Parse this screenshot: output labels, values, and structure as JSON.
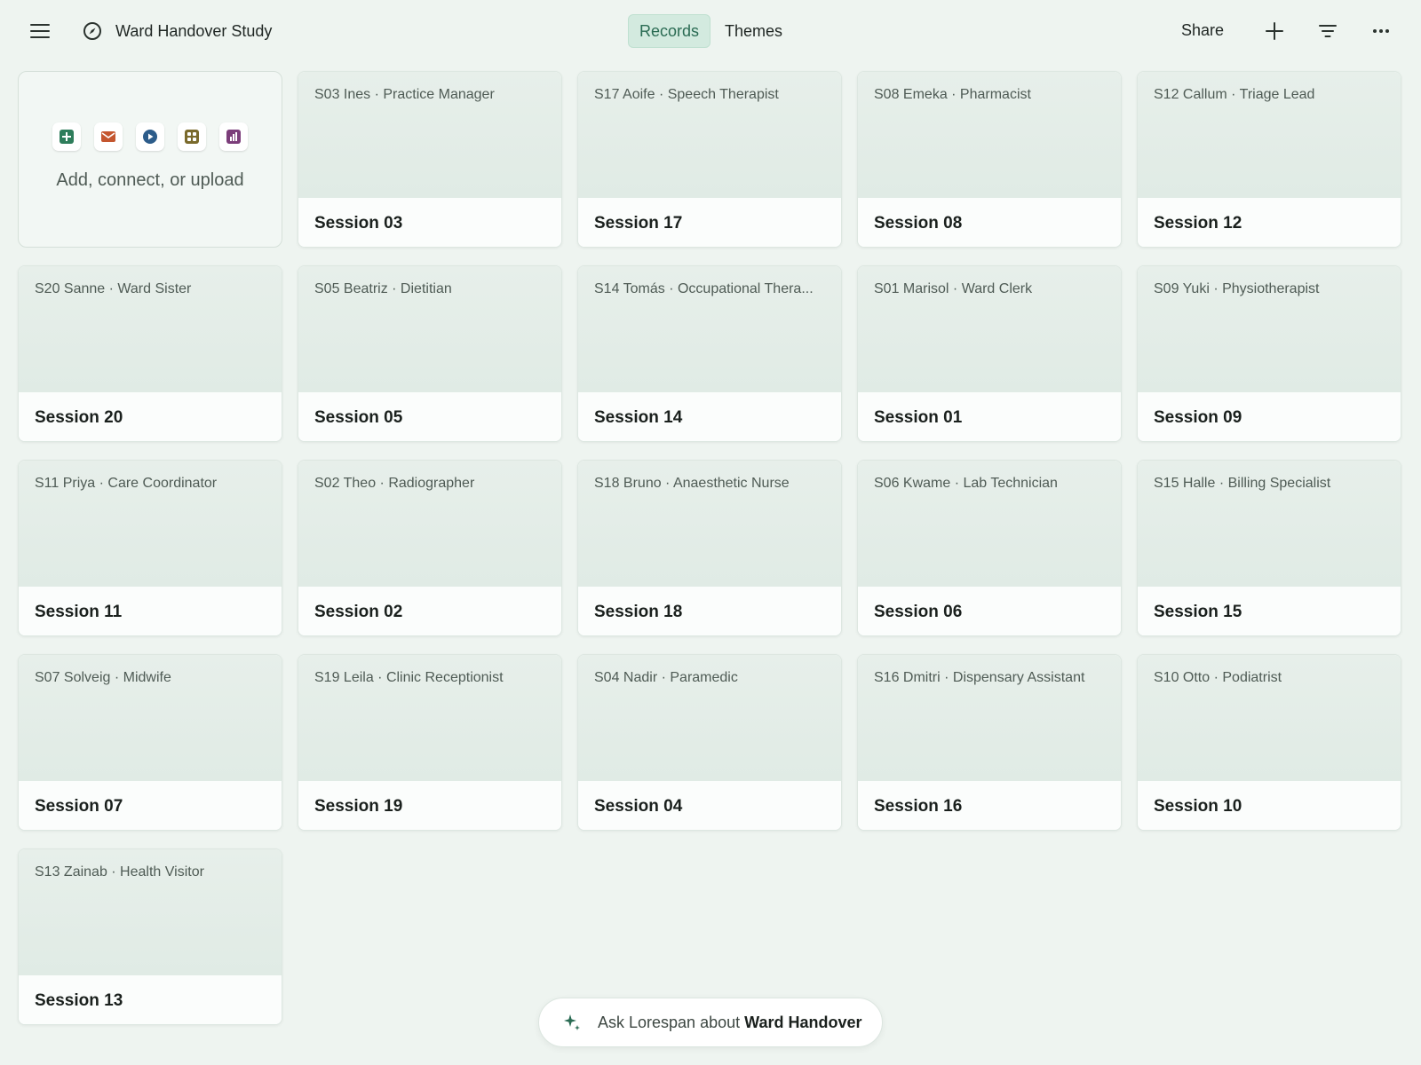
{
  "header": {
    "title": "Ward Handover Study",
    "tabs": [
      {
        "label": "Records",
        "active": true
      },
      {
        "label": "Themes",
        "active": false
      }
    ],
    "share_label": "Share"
  },
  "add_card": {
    "text": "Add, connect, or upload",
    "icons": [
      "add-icon",
      "mail-icon",
      "play-icon",
      "grid-icon",
      "chart-icon"
    ]
  },
  "records": [
    {
      "participant": "S03 Ines · Practice Manager",
      "session": "Session 03"
    },
    {
      "participant": "S17 Aoife · Speech Therapist",
      "session": "Session 17"
    },
    {
      "participant": "S08 Emeka · Pharmacist",
      "session": "Session 08"
    },
    {
      "participant": "S12 Callum · Triage Lead",
      "session": "Session 12"
    },
    {
      "participant": "S20 Sanne · Ward Sister",
      "session": "Session 20"
    },
    {
      "participant": "S05 Beatriz · Dietitian",
      "session": "Session 05"
    },
    {
      "participant": "S14 Tomás · Occupational Thera...",
      "session": "Session 14"
    },
    {
      "participant": "S01 Marisol · Ward Clerk",
      "session": "Session 01"
    },
    {
      "participant": "S09 Yuki · Physiotherapist",
      "session": "Session 09"
    },
    {
      "participant": "S11 Priya · Care Coordinator",
      "session": "Session 11"
    },
    {
      "participant": "S02 Theo · Radiographer",
      "session": "Session 02"
    },
    {
      "participant": "S18 Bruno · Anaesthetic Nurse",
      "session": "Session 18"
    },
    {
      "participant": "S06 Kwame · Lab Technician",
      "session": "Session 06"
    },
    {
      "participant": "S15 Halle · Billing Specialist",
      "session": "Session 15"
    },
    {
      "participant": "S07 Solveig · Midwife",
      "session": "Session 07"
    },
    {
      "participant": "S19 Leila · Clinic Receptionist",
      "session": "Session 19"
    },
    {
      "participant": "S04 Nadir · Paramedic",
      "session": "Session 04"
    },
    {
      "participant": "S16 Dmitri · Dispensary Assistant",
      "session": "Session 16"
    },
    {
      "participant": "S10 Otto · Podiatrist",
      "session": "Session 10"
    },
    {
      "participant": "S13 Zainab · Health Visitor",
      "session": "Session 13"
    }
  ],
  "ask_bar": {
    "prefix": "Ask Lorespan about",
    "subject": "Ward Handover"
  },
  "colors": {
    "accent": "#2a6b53",
    "active_tab_bg": "#d3eadf",
    "background": "#eef4f0"
  }
}
